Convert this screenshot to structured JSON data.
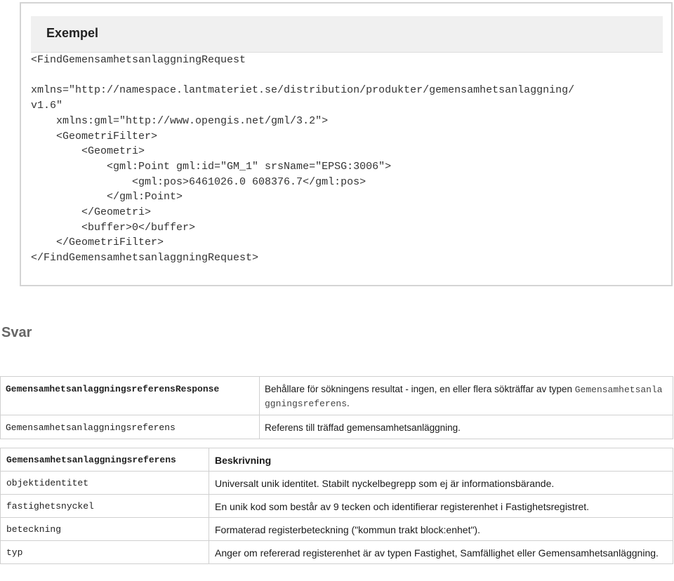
{
  "example": {
    "title": "Exempel",
    "code": "<FindGemensamhetsanlaggningRequest\n\nxmlns=\"http://namespace.lantmateriet.se/distribution/produkter/gemensamhetsanlaggning/\nv1.6\"\n    xmlns:gml=\"http://www.opengis.net/gml/3.2\">\n    <GeometriFilter>\n        <Geometri>\n            <gml:Point gml:id=\"GM_1\" srsName=\"EPSG:3006\">\n                <gml:pos>6461026.0 608376.7</gml:pos>\n            </gml:Point>\n        </Geometri>\n        <buffer>0</buffer>\n    </GeometriFilter>\n</FindGemensamhetsanlaggningRequest>"
  },
  "svar": {
    "heading": "Svar"
  },
  "response_table": {
    "rows": [
      {
        "name": "GemensamhetsanlaggningsreferensResponse",
        "description": "Behållare för sökningens resultat - ingen, en eller flera sökträffar av typen ",
        "description_code": "Gemensamhetsanlaggningsreferens",
        "description_end": "."
      },
      {
        "name": "Gemensamhetsanlaggningsreferens",
        "description": "Referens till träffad gemensamhetsanläggning."
      }
    ]
  },
  "field_table": {
    "header": {
      "name": "Gemensamhetsanlaggningsreferens",
      "description": "Beskrivning"
    },
    "rows": [
      {
        "name": "objektidentitet",
        "description": "Universalt unik identitet. Stabilt nyckelbegrepp som ej är informationsbärande."
      },
      {
        "name": "fastighetsnyckel",
        "description": "En unik kod som består av 9 tecken och identifierar registerenhet i Fastighetsregistret."
      },
      {
        "name": "beteckning",
        "description": "Formaterad registerbeteckning (\"kommun trakt block:enhet\")."
      },
      {
        "name": "typ",
        "description": "Anger om refererad registerenhet är av typen Fastighet, Samfällighet eller Gemensamhetsanläggning."
      }
    ]
  }
}
